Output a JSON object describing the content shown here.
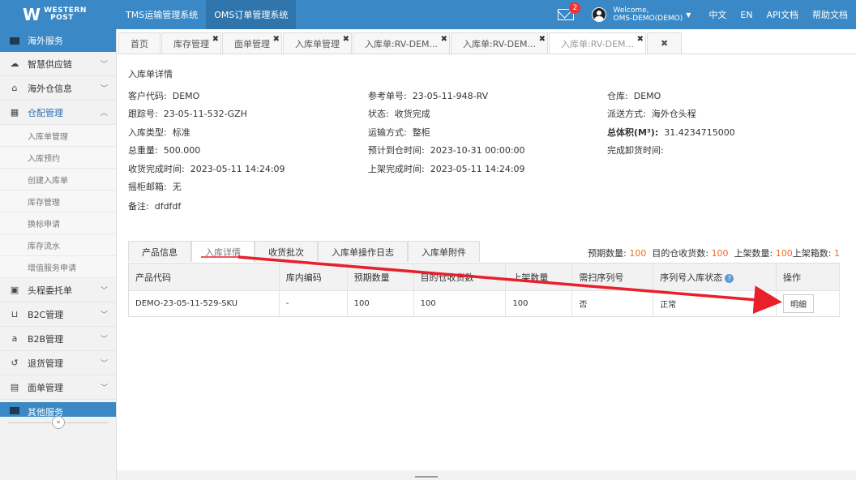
{
  "header": {
    "logo_text_1": "WESTERN",
    "logo_text_2": "POST",
    "systems": [
      "TMS运输管理系统",
      "OMS订单管理系统"
    ],
    "mail_badge": "2",
    "welcome_line1": "Welcome,",
    "welcome_line2": "OMS-DEMO(DEMO)",
    "links": [
      "中文",
      "EN",
      "API文档",
      "帮助文档"
    ]
  },
  "sidebar": {
    "head": "海外服务",
    "items": [
      {
        "label": "智慧供应链",
        "icon": "cloud-icon"
      },
      {
        "label": "海外仓信息",
        "icon": "home-icon"
      },
      {
        "label": "仓配管理",
        "icon": "grid-icon"
      }
    ],
    "sub_items": [
      "入库单管理",
      "入库预约",
      "创建入库单",
      "库存管理",
      "换标申请",
      "库存流水",
      "增值服务申请"
    ],
    "items_after": [
      {
        "label": "头程委托单",
        "icon": "briefcase-icon"
      },
      {
        "label": "B2C管理",
        "icon": "cart-icon"
      },
      {
        "label": "B2B管理",
        "icon": "amazon-icon"
      },
      {
        "label": "退货管理",
        "icon": "return-icon"
      },
      {
        "label": "面单管理",
        "icon": "document-icon"
      }
    ],
    "bottom_head": "其他服务",
    "collapse": "«"
  },
  "tabs": [
    "首页",
    "库存管理",
    "面单管理",
    "入库单管理",
    "入库单:RV-DEM...",
    "入库单:RV-DEM...",
    "入库单:RV-DEM..."
  ],
  "detail": {
    "title": "入库单详情",
    "customer_code_label": "客户代码:",
    "customer_code": "DEMO",
    "ref_no_label": "参考单号:",
    "ref_no": "23-05-11-948-RV",
    "warehouse_label": "仓库:",
    "warehouse": "DEMO",
    "tracking_label": "跟踪号:",
    "tracking": "23-05-11-532-GZH",
    "status_label": "状态:",
    "status": "收货完成",
    "delivery_label": "派送方式:",
    "delivery": "海外仓头程",
    "type_label": "入库类型:",
    "type": "标准",
    "transport_label": "运输方式:",
    "transport": "整柜",
    "volume_label": "总体积(M³):",
    "volume": "31.4234715000",
    "weight_label": "总重量:",
    "weight": "500.000",
    "eta_label": "预计到仓时间:",
    "eta": "2023-10-31 00:00:00",
    "unload_label": "完成卸货时间:",
    "unload": "",
    "received_label": "收货完成时间:",
    "received": "2023-05-11 14:24:09",
    "shelved_label": "上架完成时间:",
    "shelved": "2023-05-11 14:24:09",
    "container_label": "摇柜邮箱:",
    "container": "无",
    "remark_label": "备注:",
    "remark": "dfdfdf"
  },
  "detail_tabs": [
    "产品信息",
    "入库详情",
    "收货批次",
    "入库单操作日志",
    "入库单附件"
  ],
  "stats": {
    "expected_label": "预期数量:",
    "expected": "100",
    "received_label": "目的仓收货数:",
    "received": "100",
    "shelved_label": "上架数量:",
    "shelved": "100",
    "boxes_label": "上架箱数:",
    "boxes": "1"
  },
  "table": {
    "headers": [
      "产品代码",
      "库内编码",
      "预期数量",
      "目的仓收货数",
      "上架数量",
      "需扫序列号",
      "序列号入库状态",
      "操作"
    ],
    "rows": [
      [
        "DEMO-23-05-11-529-SKU",
        "-",
        "100",
        "100",
        "100",
        "否",
        "正常",
        "明细"
      ]
    ]
  },
  "colors": {
    "brand": "#3a88c5",
    "accent": "#f06a20",
    "arrow": "#e8202a"
  }
}
